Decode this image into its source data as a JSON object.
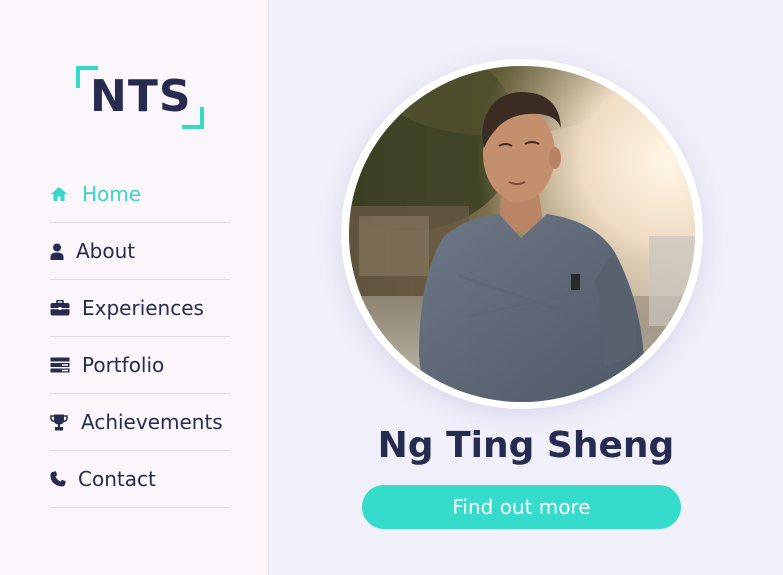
{
  "logo": {
    "text": "NTS",
    "accent_color": "#36d9c6"
  },
  "nav": {
    "items": [
      {
        "label": "Home",
        "icon": "home-icon",
        "active": true
      },
      {
        "label": "About",
        "icon": "user-icon",
        "active": false
      },
      {
        "label": "Experiences",
        "icon": "briefcase-icon",
        "active": false
      },
      {
        "label": "Portfolio",
        "icon": "layers-icon",
        "active": false
      },
      {
        "label": "Achievements",
        "icon": "trophy-icon",
        "active": false
      },
      {
        "label": "Contact",
        "icon": "phone-icon",
        "active": false
      }
    ]
  },
  "profile": {
    "name": "Ng Ting Sheng",
    "photo": "profile-photo",
    "cta_label": "Find out more"
  },
  "colors": {
    "accent": "#36dccb",
    "text_dark": "#272b4f",
    "sidebar_bg": "#fbf6fb",
    "main_bg": "#f0f0fa"
  }
}
